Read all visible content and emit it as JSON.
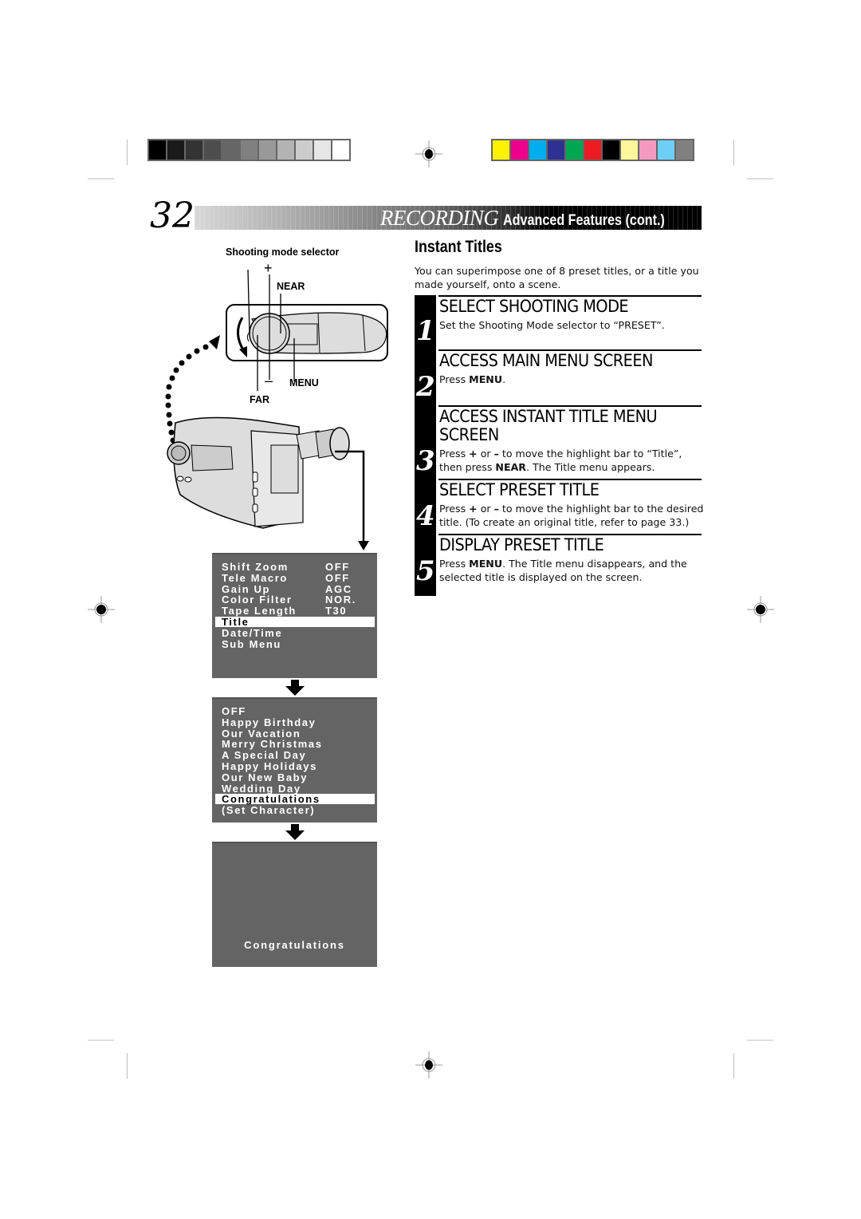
{
  "page": {
    "number": "32",
    "header": {
      "section": "RECORDING",
      "subtitle": "Advanced Features (cont.)"
    }
  },
  "print_marks": {
    "grayscale_bar": [
      "#000000",
      "#1a1a1a",
      "#333333",
      "#4d4d4d",
      "#666666",
      "#808080",
      "#999999",
      "#b3b3b3",
      "#cccccc",
      "#e6e6e6",
      "#ffffff"
    ],
    "color_bar": [
      "#fff200",
      "#ec008c",
      "#00aeef",
      "#2e3192",
      "#00a651",
      "#ed1c24",
      "#000000",
      "#fff799",
      "#f49ac1",
      "#6dcff6",
      "#808080"
    ]
  },
  "section": {
    "title": "Instant Titles",
    "intro": "You can superimpose one of 8 preset titles, or a title you made yourself, onto a scene."
  },
  "steps": [
    {
      "number": "1",
      "heading": "SELECT SHOOTING MODE",
      "body": "Set the Shooting Mode selector to “PRESET”."
    },
    {
      "number": "2",
      "heading": "ACCESS MAIN MENU SCREEN",
      "body_parts": [
        "Press ",
        "MENU",
        "."
      ]
    },
    {
      "number": "3",
      "heading": "ACCESS INSTANT TITLE MENU SCREEN",
      "body_parts": [
        "Press ",
        "+",
        " or ",
        "–",
        " to move the highlight bar to “Title”, then press ",
        "NEAR",
        ". The Title menu appears."
      ]
    },
    {
      "number": "4",
      "heading": "SELECT PRESET TITLE",
      "body_parts": [
        "Press ",
        "+",
        " or ",
        "–",
        " to move the highlight bar to the desired title. (To create an original title, refer to page 33.)"
      ]
    },
    {
      "number": "5",
      "heading": "DISPLAY PRESET TITLE",
      "body_parts": [
        "Press ",
        "MENU",
        ". The Title menu disappears, and the selected title is displayed on the screen."
      ]
    }
  ],
  "diagram": {
    "labels": {
      "selector": "Shooting mode selector",
      "plus": "+",
      "near": "NEAR",
      "minus": "–",
      "menu": "MENU",
      "far": "FAR"
    }
  },
  "main_menu": {
    "rows": [
      {
        "label": "Shift Zoom",
        "value": "OFF",
        "highlighted": false
      },
      {
        "label": "Tele Macro",
        "value": "OFF",
        "highlighted": false
      },
      {
        "label": "Gain Up",
        "value": "AGC",
        "highlighted": false
      },
      {
        "label": "Color Filter",
        "value": "NOR.",
        "highlighted": false
      },
      {
        "label": "Tape Length",
        "value": "T30",
        "highlighted": false
      },
      {
        "label": "Title",
        "value": "",
        "highlighted": true
      },
      {
        "label": "Date/Time",
        "value": "",
        "highlighted": false
      },
      {
        "label": "Sub Menu",
        "value": "",
        "highlighted": false
      }
    ]
  },
  "title_menu": {
    "rows": [
      {
        "label": "OFF",
        "highlighted": false
      },
      {
        "label": "Happy Birthday",
        "highlighted": false
      },
      {
        "label": "Our Vacation",
        "highlighted": false
      },
      {
        "label": "Merry Christmas",
        "highlighted": false
      },
      {
        "label": "A Special Day",
        "highlighted": false
      },
      {
        "label": "Happy Holidays",
        "highlighted": false
      },
      {
        "label": "Our New Baby",
        "highlighted": false
      },
      {
        "label": "Wedding Day",
        "highlighted": false
      },
      {
        "label": "Congratulations",
        "highlighted": true
      },
      {
        "label": "(Set Character)",
        "highlighted": false
      }
    ]
  },
  "result_screen": {
    "title": "Congratulations"
  }
}
